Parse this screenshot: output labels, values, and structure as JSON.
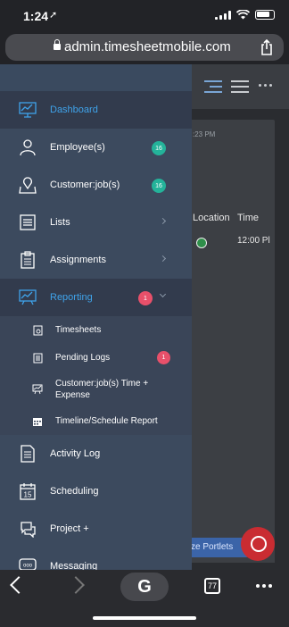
{
  "status_bar": {
    "time": "1:24",
    "location_glyph": "➚"
  },
  "browser": {
    "url": "admin.timesheetmobile.com"
  },
  "background": {
    "timestamp": ":23 PM",
    "col_location": "Location",
    "col_time": "Time",
    "row_time": "12:00 Pl",
    "portlets_button": "ze Portlets"
  },
  "drawer": {
    "items": [
      {
        "label": "Dashboard"
      },
      {
        "label": "Employee(s)",
        "badge": "16"
      },
      {
        "label": "Customer:job(s)",
        "badge": "16"
      },
      {
        "label": "Lists"
      },
      {
        "label": "Assignments"
      },
      {
        "label": "Reporting",
        "badge": "1"
      }
    ],
    "reporting_sub": [
      {
        "label": "Timesheets"
      },
      {
        "label": "Pending Logs",
        "badge": "1"
      },
      {
        "label_line1": "Customer:job(s) Time +",
        "label_line2": "Expense"
      },
      {
        "label": "Timeline/Schedule Report"
      }
    ],
    "items2": [
      {
        "label": "Activity Log"
      },
      {
        "label": "Scheduling",
        "icon_text": "15"
      },
      {
        "label": "Project +"
      },
      {
        "label": "Messaging",
        "icon_text": "ooo"
      }
    ]
  },
  "toolbar": {
    "g_label": "G",
    "tab_count": "77"
  },
  "colors": {
    "accent": "#3fa3ea",
    "badge_teal": "#24b39a",
    "badge_red": "#e8506a",
    "drawer_bg": "#3c4a5e"
  }
}
